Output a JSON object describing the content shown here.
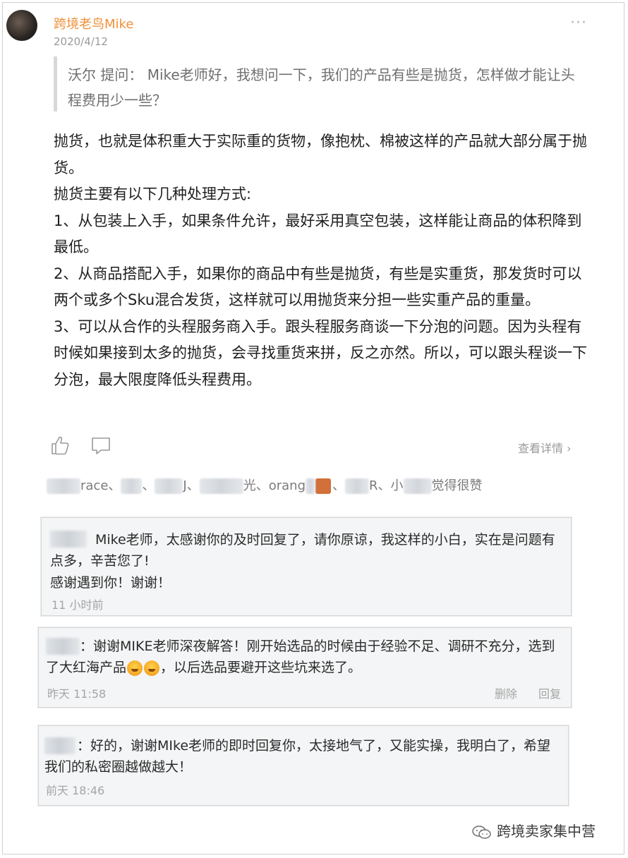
{
  "post": {
    "author": "跨境老鸟Mike",
    "date": "2020/4/12",
    "more_icon": "···",
    "question": "沃尔  提问：  Mike老师好，我想问一下，我们的产品有些是抛货，怎样做才能让头程费用少一些？",
    "answer_lines": [
      "抛货，也就是体积重大于实际重的货物，像抱枕、棉被这样的产品就大部分属于抛货。",
      "抛货主要有以下几种处理方式:",
      "1、从包装上入手，如果条件允许，最好采用真空包装，这样能让商品的体积降到最低。",
      "2、从商品搭配入手，如果你的商品中有些是抛货，有些是实重货，那发货时可以两个或多个Sku混合发货，这样就可以用抛货来分担一些实重产品的重量。",
      "3、可以从合作的头程服务商入手。跟头程服务商谈一下分泡的问题。因为头程有时候如果接到太多的抛货，会寻找重货来拼，反之亦然。所以，可以跟头程谈一下分泡，最大限度降低头程费用。"
    ],
    "detail_link": "查看详情 ›",
    "likers": {
      "p1": "race、",
      "p2": "、",
      "p3": "J、",
      "p4": "光、orang",
      "p5": "、",
      "p6": "R、小",
      "suffix": "觉得很赞"
    }
  },
  "comments": [
    {
      "text": "Mike老师，太感谢你的及时回复了，请你原谅，我这样的小白，实在是问题有点多，辛苦您了!",
      "text2": "感谢遇到你！谢谢！",
      "time": "11 小时前"
    },
    {
      "text_a": "：谢谢MIKE老师深夜解答！刚开始选品的时候由于经验不足、调研不充分，选到了大红海产品",
      "text_b": "，以后选品要避开这些坑来选了。",
      "time": "昨天 11:58",
      "delete_label": "删除",
      "reply_label": "回复"
    },
    {
      "text": "：好的，谢谢MIke老师的即时回复你，太接地气了，又能实操，我明白了，希望我们的私密圈越做越大！",
      "time": "前天 18:46"
    }
  ],
  "footer": {
    "account": "跨境卖家集中营"
  }
}
